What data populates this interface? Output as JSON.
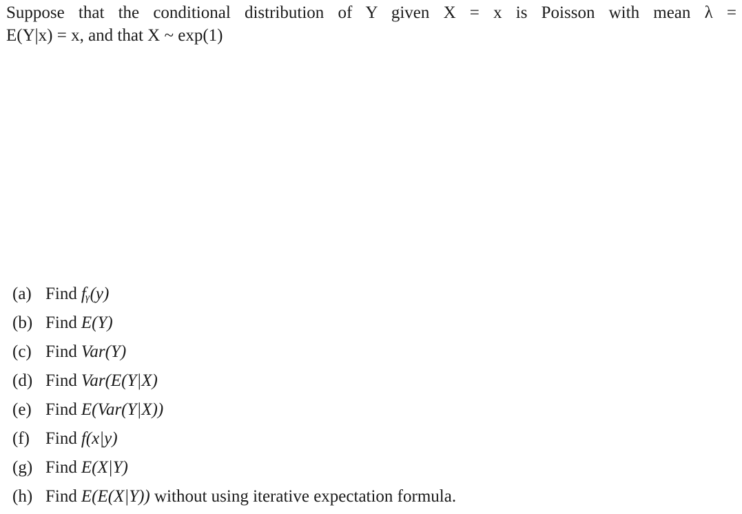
{
  "problem": {
    "intro_line1": "Suppose that the conditional distribution of Y given X = x is Poisson with mean λ =",
    "intro_line2": "E(Y|x) = x, and that X ~ exp(1)"
  },
  "parts": [
    {
      "label": "(a)",
      "verb": "Find",
      "expr": "fᵧ(y)",
      "tail": ""
    },
    {
      "label": "(b)",
      "verb": "Find",
      "expr": "E(Y)",
      "tail": ""
    },
    {
      "label": "(c)",
      "verb": "Find",
      "expr": "Var(Y)",
      "tail": ""
    },
    {
      "label": "(d)",
      "verb": "Find",
      "expr": "Var(E(Y|X)",
      "tail": ""
    },
    {
      "label": "(e)",
      "verb": "Find",
      "expr": "E(Var(Y|X))",
      "tail": ""
    },
    {
      "label": "(f)",
      "verb": "Find",
      "expr": "f(x|y)",
      "tail": ""
    },
    {
      "label": "(g)",
      "verb": "Find",
      "expr": "E(X|Y)",
      "tail": ""
    },
    {
      "label": "(h)",
      "verb": "Find",
      "expr": "E(E(X|Y))",
      "tail": " without using iterative expectation formula."
    }
  ]
}
